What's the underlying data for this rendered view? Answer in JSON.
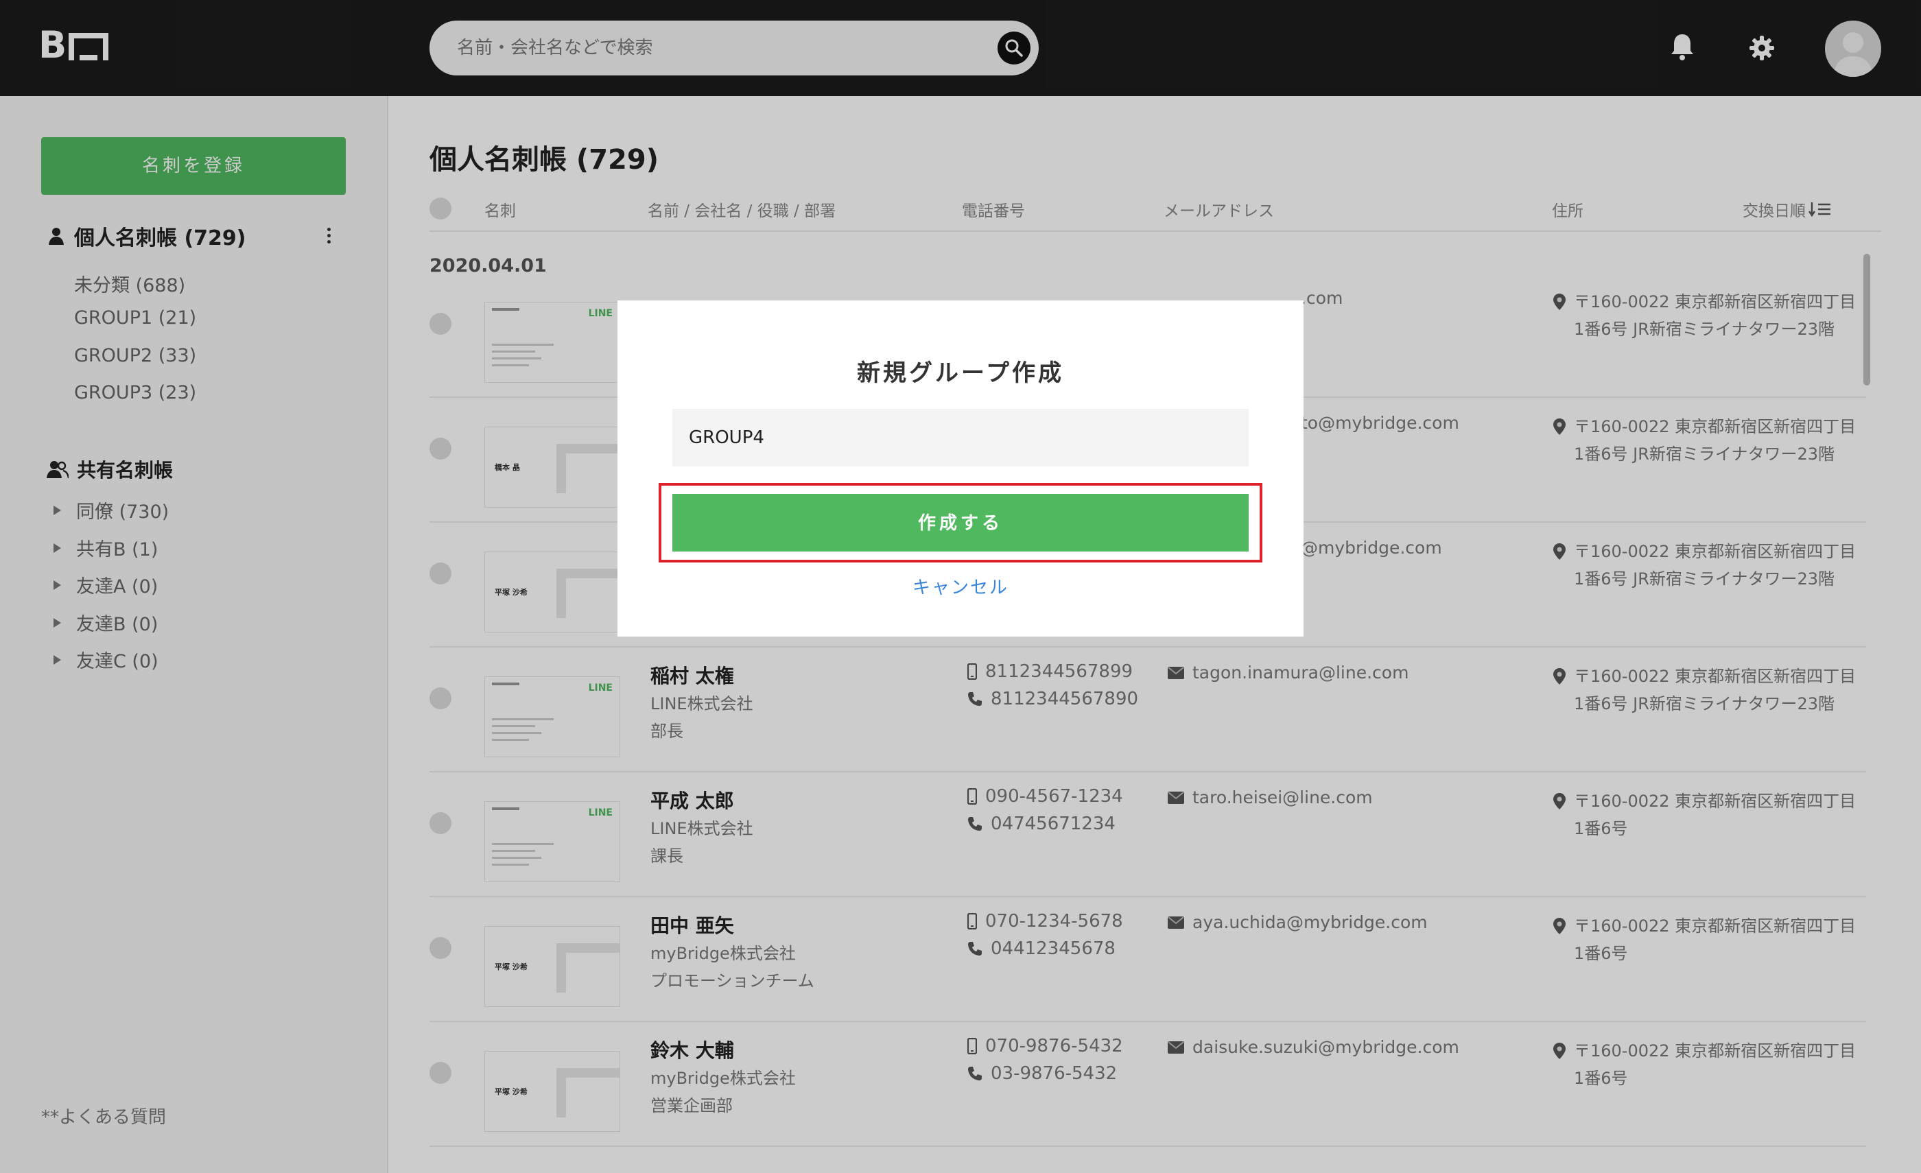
{
  "header": {
    "logo_text": "B",
    "search_placeholder": "名前・会社名などで検索",
    "icons": [
      "search-icon",
      "bell-icon",
      "gear-icon",
      "avatar"
    ]
  },
  "sidebar": {
    "register_label": "名刺を登録",
    "personal_label": "個人名刺帳 (729)",
    "personal_items": [
      {
        "label": "未分類 (688)"
      },
      {
        "label": "GROUP1 (21)"
      },
      {
        "label": "GROUP2 (33)"
      },
      {
        "label": "GROUP3 (23)"
      }
    ],
    "shared_label": "共有名刺帳",
    "shared_items": [
      {
        "label": "同僚 (730)"
      },
      {
        "label": "共有B (1)"
      },
      {
        "label": "友達A (0)"
      },
      {
        "label": "友達B (0)"
      },
      {
        "label": "友達C (0)"
      }
    ],
    "faq_label": "**よくある質問"
  },
  "main": {
    "title": "個人名刺帳 (729)",
    "columns": {
      "card": "名刺",
      "name": "名前 / 会社名 / 役職 / 部署",
      "phone": "電話番号",
      "email": "メールアドレス",
      "address": "住所",
      "sort": "交換日順"
    },
    "date_group": "2020.04.01",
    "rows": [
      {
        "name": "",
        "company": "",
        "dept": "",
        "phone1": "",
        "phone2": "",
        "email": ".com",
        "addr1": "〒160-0022 東京都新宿区新宿四丁目",
        "addr2": "1番6号 JR新宿ミライナタワー23階",
        "card_type": "line"
      },
      {
        "name": "",
        "company": "",
        "dept": "",
        "phone1": "",
        "phone2": "",
        "email": "to@mybridge.com",
        "addr1": "〒160-0022 東京都新宿区新宿四丁目",
        "addr2": "1番6号 JR新宿ミライナタワー23階",
        "card_type": "mybridge",
        "card_name": "橋本 晶"
      },
      {
        "name": "",
        "company": "",
        "dept": "",
        "phone1": "",
        "phone2": "",
        "email": "@mybridge.com",
        "addr1": "〒160-0022 東京都新宿区新宿四丁目",
        "addr2": "1番6号 JR新宿ミライナタワー23階",
        "card_type": "mybridge",
        "card_name": "平塚 沙希"
      },
      {
        "name": "稲村 太権",
        "company": "LINE株式会社",
        "dept": "部長",
        "phone1": "8112344567899",
        "phone2": "8112344567890",
        "email": "tagon.inamura@line.com",
        "addr1": "〒160-0022 東京都新宿区新宿四丁目",
        "addr2": "1番6号 JR新宿ミライナタワー23階",
        "card_type": "line"
      },
      {
        "name": "平成 太郎",
        "company": "LINE株式会社",
        "dept": "課長",
        "phone1": "090-4567-1234",
        "phone2": "04745671234",
        "email": "taro.heisei@line.com",
        "addr1": "〒160-0022 東京都新宿区新宿四丁目",
        "addr2": "1番6号",
        "card_type": "line"
      },
      {
        "name": "田中 亜矢",
        "company": "myBridge株式会社",
        "dept": "プロモーションチーム",
        "phone1": "070-1234-5678",
        "phone2": "04412345678",
        "email": "aya.uchida@mybridge.com",
        "addr1": "〒160-0022 東京都新宿区新宿四丁目",
        "addr2": "1番6号",
        "card_type": "mybridge",
        "card_name": "平塚 沙希"
      },
      {
        "name": "鈴木 大輔",
        "company": "myBridge株式会社",
        "dept": "営業企画部",
        "phone1": "070-9876-5432",
        "phone2": "03-9876-5432",
        "email": "daisuke.suzuki@mybridge.com",
        "addr1": "〒160-0022 東京都新宿区新宿四丁目",
        "addr2": "1番6号",
        "card_type": "mybridge",
        "card_name": "平塚 沙希"
      }
    ]
  },
  "dialog": {
    "title": "新規グループ作成",
    "input_value": "GROUP4",
    "create_label": "作成する",
    "cancel_label": "キャンセル",
    "highlight_color": "#e0222a"
  },
  "colors": {
    "accent_green": "#50b85f",
    "link_blue": "#3a86d8",
    "header_bg": "#1b1b1b"
  }
}
